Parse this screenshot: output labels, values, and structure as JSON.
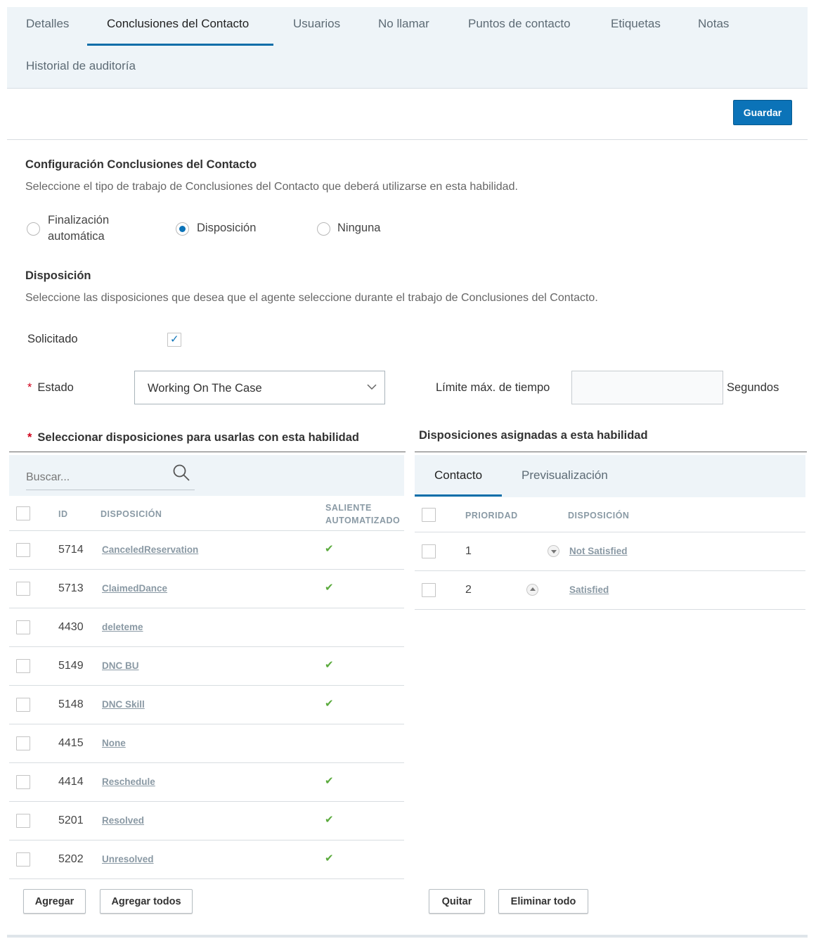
{
  "tabs": [
    {
      "label": "Detalles"
    },
    {
      "label": "Conclusiones del Contacto"
    },
    {
      "label": "Usuarios"
    },
    {
      "label": "No llamar"
    },
    {
      "label": "Puntos de contacto"
    },
    {
      "label": "Etiquetas"
    },
    {
      "label": "Notas"
    },
    {
      "label": "Historial de auditoría"
    }
  ],
  "active_tab": "Conclusiones del Contacto",
  "toolbar": {
    "save_label": "Guardar"
  },
  "config": {
    "title": "Configuración Conclusiones del Contacto",
    "description": "Seleccione el tipo de trabajo de Conclusiones del Contacto que deberá utilizarse en esta habilidad.",
    "options": [
      {
        "label_line1": "Finalización",
        "label_line2": "automática",
        "checked": false
      },
      {
        "label": "Disposición",
        "checked": true
      },
      {
        "label": "Ninguna",
        "checked": false
      }
    ]
  },
  "disposition": {
    "title": "Disposición",
    "description": "Seleccione las disposiciones que desea que el agente seleccione durante el trabajo de Conclusiones del Contacto.",
    "requested_label": "Solicitado",
    "requested_checked": true,
    "state_label": "Estado",
    "state_value": "Working On The Case",
    "time_limit_label": "Límite máx. de tiempo",
    "time_limit_value": "",
    "seconds_label": "Segundos"
  },
  "available": {
    "title": "Seleccionar disposiciones para usarlas con esta habilidad",
    "search_placeholder": "Buscar...",
    "columns": {
      "id": "ID",
      "disposition": "DISPOSICIÓN",
      "outbound_line1": "SALIENTE",
      "outbound_line2": "AUTOMATIZADO"
    },
    "rows": [
      {
        "id": "5714",
        "name": "CanceledReservation",
        "outbound": true
      },
      {
        "id": "5713",
        "name": "ClaimedDance",
        "outbound": true
      },
      {
        "id": "4430",
        "name": "deleteme",
        "outbound": false
      },
      {
        "id": "5149",
        "name": "DNC BU",
        "outbound": true
      },
      {
        "id": "5148",
        "name": "DNC Skill",
        "outbound": true
      },
      {
        "id": "4415",
        "name": "None",
        "outbound": false
      },
      {
        "id": "4414",
        "name": "Reschedule",
        "outbound": true
      },
      {
        "id": "5201",
        "name": "Resolved",
        "outbound": true
      },
      {
        "id": "5202",
        "name": "Unresolved",
        "outbound": true
      }
    ],
    "add_label": "Agregar",
    "add_all_label": "Agregar todos"
  },
  "assigned": {
    "title": "Disposiciones asignadas a esta habilidad",
    "tabs": [
      {
        "label": "Contacto"
      },
      {
        "label": "Previsualización"
      }
    ],
    "columns": {
      "priority": "PRIORIDAD",
      "disposition": "DISPOSICIÓN"
    },
    "rows": [
      {
        "priority": "1",
        "name": "Not Satisfied",
        "arrow": "down"
      },
      {
        "priority": "2",
        "name": "Satisfied",
        "arrow": "up"
      }
    ],
    "remove_label": "Quitar",
    "remove_all_label": "Eliminar todo"
  },
  "colors": {
    "accent": "#0b73b8",
    "check": "#5aaa3c",
    "required": "#d0021b"
  }
}
